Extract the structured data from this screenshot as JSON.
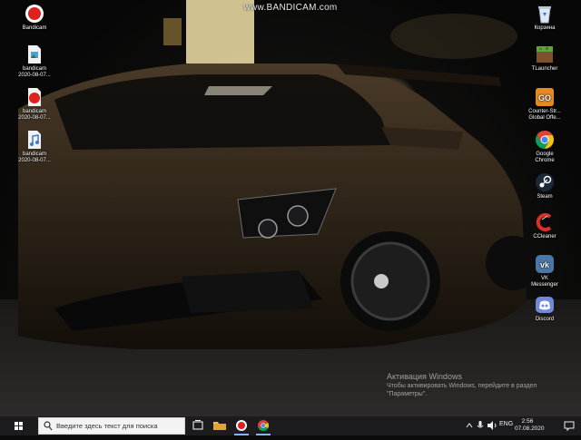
{
  "watermark": "www.BANDICAM.com",
  "desktop": {
    "left_icons": [
      {
        "name": "bandicam-app-shortcut",
        "icon": "bandicam-record-icon",
        "label": "Bandicam"
      },
      {
        "name": "bandicam-image-file-1",
        "icon": "image-file-icon",
        "label": "bandicam\n2020-08-07..."
      },
      {
        "name": "bandicam-video-file",
        "icon": "bandicam-video-icon",
        "label": "bandicam\n2020-08-07..."
      },
      {
        "name": "bandicam-audio-file",
        "icon": "audio-file-icon",
        "label": "bandicam\n2020-08-07..."
      }
    ],
    "right_icons": [
      {
        "name": "recycle-bin",
        "icon": "recycle-bin-icon",
        "label": "Корзина"
      },
      {
        "name": "tlauncher",
        "icon": "minecraft-block-icon",
        "label": "TLauncher"
      },
      {
        "name": "counter-strike",
        "icon": "counter-strike-icon",
        "label": "Counter-Str...\nGlobal Offe..."
      },
      {
        "name": "google-chrome",
        "icon": "chrome-icon",
        "label": "Google\nChrome"
      },
      {
        "name": "steam",
        "icon": "steam-icon",
        "label": "Steam"
      },
      {
        "name": "ccleaner",
        "icon": "ccleaner-icon",
        "label": "CCleaner"
      },
      {
        "name": "vk-messenger",
        "icon": "vk-icon",
        "label": "VK\nMessenger"
      },
      {
        "name": "discord",
        "icon": "discord-icon",
        "label": "Discord"
      }
    ]
  },
  "activation": {
    "title": "Активация Windows",
    "text": "Чтобы активировать Windows, перейдите в раздел \"Параметры\"."
  },
  "taskbar": {
    "search_placeholder": "Введите здесь текст для поиска",
    "pinned": [
      {
        "name": "task-view",
        "icon": "task-view-icon"
      },
      {
        "name": "file-explorer",
        "icon": "folder-icon"
      },
      {
        "name": "bandicam",
        "icon": "bandicam-record-icon"
      },
      {
        "name": "chrome",
        "icon": "chrome-icon"
      }
    ],
    "tray": {
      "language": "ENG",
      "time": "2:56",
      "date": "07.08.2020"
    }
  },
  "colors": {
    "taskbar": "#1c1c1f",
    "bandicam_red": "#e0201c",
    "chrome_red": "#db4437",
    "chrome_yellow": "#f4c20d",
    "chrome_green": "#0f9d58",
    "chrome_blue": "#4285f4",
    "steam_blue": "#1b2838",
    "vk_blue": "#4a76a8",
    "discord_blurple": "#7289da"
  }
}
